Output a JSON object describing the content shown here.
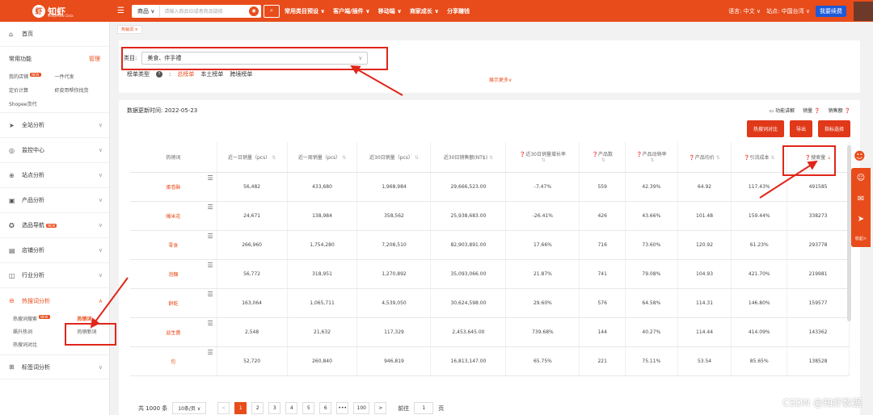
{
  "topbar": {
    "logo": "知虾",
    "logo_sub": "ShopeeBiz Data",
    "search_category": "商品",
    "search_placeholder": "请输入商品ID或者商品链接",
    "nav": [
      "常用类目预设 ∨",
      "客户端/插件 ∨",
      "移动端 ∨",
      "商家成长 ∨",
      "分享赚钱"
    ],
    "language": "语言: 中文 ∨",
    "site": "站点: 中国台湾 ∨",
    "free_btn": "我要续费"
  },
  "sidebar": {
    "home": "首页",
    "common_title": "常用功能",
    "manage": "管理",
    "common_items": [
      "我的店铺",
      "一件代发",
      "定价计算",
      "虾皮哥帮你找货",
      "Shopee货代"
    ],
    "new_tag": "NEW",
    "menu": [
      "全站分析",
      "监控中心",
      "站点分析",
      "产品分析",
      "选品导航",
      "店铺分析",
      "行业分析",
      "热搜词分析"
    ],
    "hot_sub": [
      "热搜词搜索",
      "热销词",
      "飙升热词",
      "热销新词",
      "热搜词对比"
    ],
    "bottom": "标签词分析"
  },
  "tab": {
    "label": "热销词 ×"
  },
  "filter": {
    "category_label": "类目:",
    "category_value": "美食、伴手禮",
    "rank_type_label": "榜单类型",
    "rank_types": [
      "总榜单",
      "本土榜单",
      "跨境榜单"
    ],
    "expand": "展示更多∨"
  },
  "main": {
    "updated": "数据更新时间: 2022-05-23",
    "tools": [
      "功能讲解",
      "销量",
      "销售额"
    ],
    "buttons": [
      "热搜词对比",
      "导出",
      "指标选择"
    ],
    "headers": [
      "热销词",
      "近一日销量（pcs）",
      "近一周销量（pcs）",
      "近30日销量（pcs）",
      "近30日销售额(NT$)",
      "近30日销量增长率",
      "产品数",
      "产品动销率",
      "产品均价",
      "引流成本",
      "搜索量"
    ],
    "rows": [
      [
        "蛋卷酥",
        "56,482",
        "433,680",
        "1,968,984",
        "29,666,523.00",
        "-7.47%",
        "559",
        "42.39%",
        "64.92",
        "117.43%",
        "491585"
      ],
      [
        "爆米花",
        "24,671",
        "138,984",
        "358,562",
        "25,938,683.00",
        "-26.41%",
        "426",
        "43.66%",
        "101.48",
        "159.44%",
        "338273"
      ],
      [
        "零食",
        "266,960",
        "1,754,280",
        "7,208,510",
        "82,903,891.00",
        "17.66%",
        "716",
        "73.60%",
        "120.92",
        "61.23%",
        "293778"
      ],
      [
        "泡麵",
        "56,772",
        "318,951",
        "1,270,892",
        "35,093,066.00",
        "21.87%",
        "741",
        "79.08%",
        "104.93",
        "421.70%",
        "219981"
      ],
      [
        "餅乾",
        "163,064",
        "1,065,711",
        "4,539,050",
        "30,624,598.00",
        "29.60%",
        "576",
        "64.58%",
        "114.31",
        "146.80%",
        "159577"
      ],
      [
        "益生菌",
        "2,548",
        "21,632",
        "117,329",
        "2,453,645.00",
        "739.68%",
        "144",
        "40.27%",
        "114.44",
        "414.09%",
        "143362"
      ],
      [
        "包",
        "52,720",
        "260,840",
        "946,819",
        "16,813,147.00",
        "65.75%",
        "221",
        "75.11%",
        "53.54",
        "85.65%",
        "138528"
      ]
    ]
  },
  "pager": {
    "total": "共 1000 条",
    "size": "10条/页 ∨",
    "prev": "<",
    "pages": [
      "1",
      "2",
      "3",
      "4",
      "5",
      "6",
      "•••",
      "100"
    ],
    "next": ">",
    "goto_label": "前往",
    "goto_value": "1",
    "goto_suffix": "页"
  },
  "float": {
    "collapse": "收起>"
  },
  "watermark": "CSDN @知虾数据"
}
